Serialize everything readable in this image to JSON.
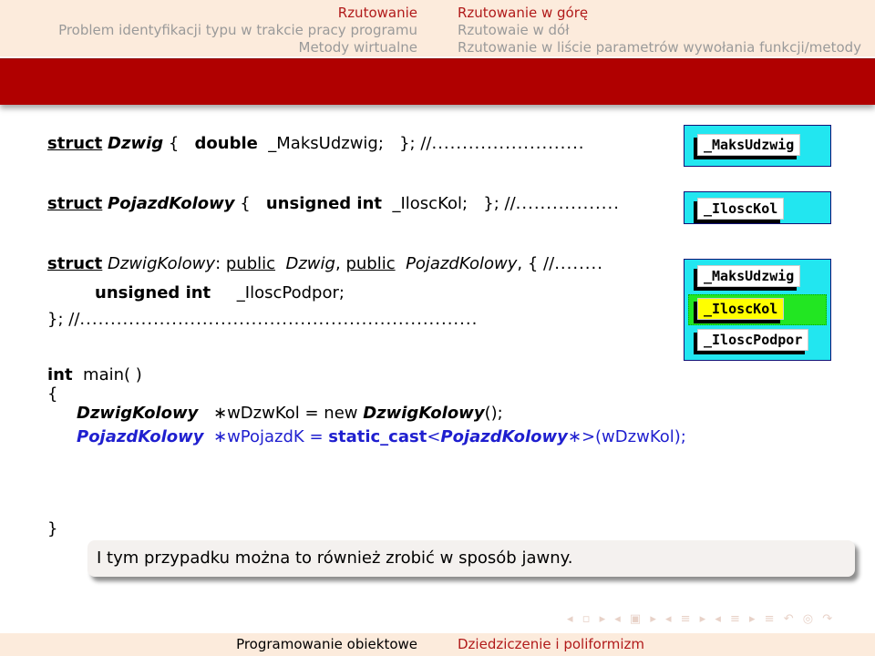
{
  "header": {
    "left": [
      {
        "label": "Rzutowanie",
        "active": true
      },
      {
        "label": "Problem identyfikacji typu w trakcie pracy programu",
        "active": false
      },
      {
        "label": "Metody wirtualne",
        "active": false
      }
    ],
    "right": [
      {
        "label": "Rzutowanie w górę",
        "active": true
      },
      {
        "label": "Rzutowaie w dół",
        "active": false
      },
      {
        "label": "Rzutowanie w liście parametrów wywołania funkcji/metody",
        "active": false
      }
    ]
  },
  "code": {
    "struct_kw": "struct",
    "line1": {
      "name": "Dzwig",
      "brace": "{",
      "type": "double",
      "field": "_MaksUdzwig;",
      "end": "};",
      "comment": "//",
      "dots": "........................."
    },
    "line2": {
      "name": "PojazdKolowy",
      "brace": "{",
      "type": "unsigned int",
      "field": "_IloscKol;",
      "end": "};",
      "comment": "//",
      "dots": "................."
    },
    "line3": {
      "name": "DzwigKolowy",
      "colon": ":",
      "public_kw": "public",
      "base1": "Dzwig",
      "comma": ",",
      "base2": "PojazdKolowy",
      "brace": ", {",
      "comment": "//",
      "dots": "........"
    },
    "line4": {
      "type": "unsigned int",
      "field": "_IloscPodpor;"
    },
    "line5": {
      "end": "};",
      "comment": "//",
      "dots": "................................................................."
    },
    "main_sig": {
      "type": "int",
      "name": "main( )"
    },
    "open_brace": "{",
    "stmt1": {
      "type": "DzwigKolowy",
      "rest": "∗wDzwKol = new ",
      "ctor": "DzwigKolowy",
      "tail": "();"
    },
    "stmt2": {
      "type": "PojazdKolowy",
      "rest": "∗wPojazdK = ",
      "cast": "static_cast",
      "lt": "<",
      "target": "PojazdKolowy",
      "tail": "∗>(wDzwKol);"
    },
    "close_brace": "}"
  },
  "diagram": {
    "dzwig_fields": [
      "_MaksUdzwig"
    ],
    "pojazd_fields": [
      "_IloscKol"
    ],
    "dzwigkolowy_fields": [
      "_MaksUdzwig",
      "_IloscKol",
      "_IloscPodpor"
    ],
    "highlighted_field": "_IloscKol",
    "colors": {
      "panel": "#22e6f0",
      "highlight": "#ffff00",
      "highlight_border": "#22e622"
    }
  },
  "note": "I tym przypadku można to również zrobić w sposób jawny.",
  "nav_symbols": "◂ ▫ ▸ ◂ ▣ ▸ ◂ ≡ ▸ ◂ ≡ ▸   ≡   ↶ ◎ ↷",
  "footer": {
    "left": "Programowanie obiektowe",
    "right": "Dziedziczenie i poliformizm"
  },
  "colors": {
    "accent": "#b00000",
    "header_bg": "#fcebdc",
    "link_red": "#b11a1a"
  }
}
